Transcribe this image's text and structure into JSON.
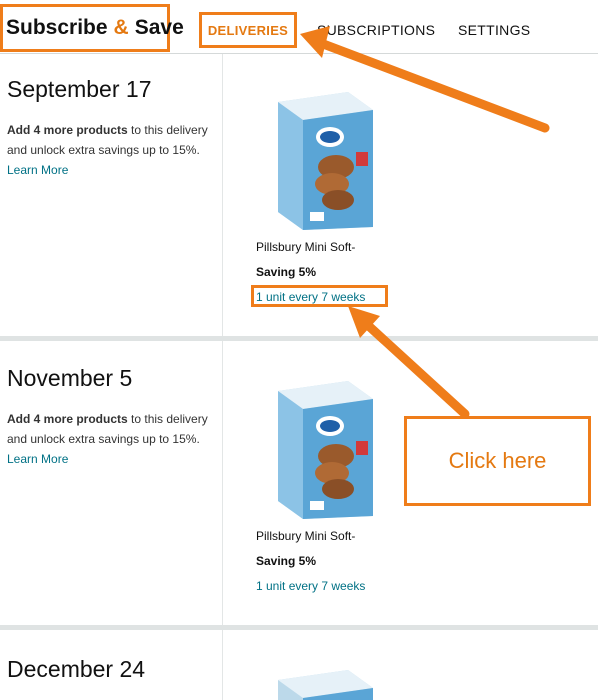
{
  "header": {
    "brand_left": "Subscribe",
    "brand_amp": "&",
    "brand_right": "Save",
    "tabs": [
      {
        "label": "DELIVERIES",
        "active": true
      },
      {
        "label": "SUBSCRIPTIONS",
        "active": false
      },
      {
        "label": "SETTINGS",
        "active": false
      }
    ]
  },
  "deliveries": [
    {
      "date": "September 17",
      "note_bold": "Add 4 more products",
      "note_rest": " to this delivery and unlock extra savings up to 15%.",
      "learn_more": "Learn More",
      "product_name": "Pillsbury Mini Soft-",
      "saving": "Saving 5%",
      "frequency": "1 unit every 7 weeks"
    },
    {
      "date": "November 5",
      "note_bold": "Add 4 more products",
      "note_rest": " to this delivery and unlock extra savings up to 15%.",
      "learn_more": "Learn More",
      "product_name": "Pillsbury Mini Soft-",
      "saving": "Saving 5%",
      "frequency": "1 unit every 7 weeks"
    },
    {
      "date": "December 24"
    }
  ],
  "callout": {
    "text": "Click here"
  },
  "colors": {
    "accent": "#ef7d1a",
    "link": "#007185",
    "brand_amp": "#e47911"
  }
}
